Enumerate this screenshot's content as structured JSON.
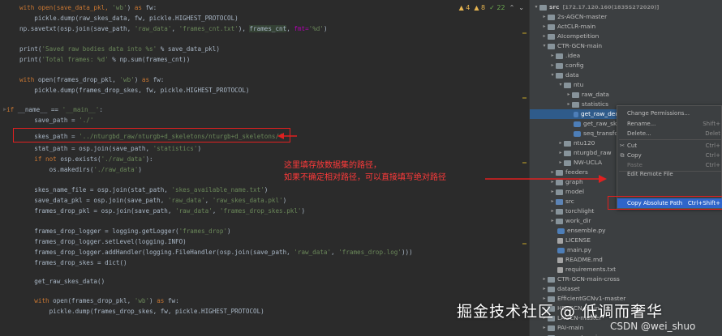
{
  "editor": {
    "toolbar": {
      "warnings": "▲ 4",
      "weak": "▲ 8",
      "typos": "✓ 22",
      "nav_up": "⌃",
      "nav_down": "⌄"
    },
    "code": {
      "l1": [
        "with open(save_data_pkl, ",
        "'wb'",
        ") ",
        "as ",
        "fw:"
      ],
      "l2": [
        "    pickle.dump(raw_skes_data, fw, pickle.HIGHEST_PROTOCOL)"
      ],
      "l3": [
        "np.savetxt(osp.join(save_path, ",
        "'raw_data'",
        ", ",
        "'frames_cnt.txt'",
        "), ",
        "frames_cnt",
        ", ",
        "fmt=",
        "'%d'",
        ")"
      ],
      "l4": [
        "print(",
        "'Saved raw bodies data into %s'",
        " % save_data_pkl)"
      ],
      "l5": [
        "print(",
        "'Total frames: %d'",
        " % np.sum(frames_cnt))"
      ],
      "l6": [
        "with ",
        "open(frames_drop_pkl, ",
        "'wb'",
        ") ",
        "as ",
        "fw:"
      ],
      "l7": [
        "    pickle.dump(frames_drop_skes, fw, pickle.HIGHEST_PROTOCOL)"
      ],
      "l8": [
        "if ",
        "__name__ == ",
        "'__main__'",
        ":"
      ],
      "l9": [
        "    save_path = ",
        "'./'"
      ],
      "l10": [
        "    skes_path = ",
        "'../nturgbd_raw/nturgb+d_skeletons/nturgb+d_skeletons/'"
      ],
      "l11": [
        "    stat_path = osp.join(save_path, ",
        "'statistics'",
        ")"
      ],
      "l12": [
        "    ",
        "if not ",
        "osp.exists(",
        "'./raw_data'",
        "):"
      ],
      "l13": [
        "        os.makedirs(",
        "'./raw_data'",
        ")"
      ],
      "l14": [
        "    skes_name_file = osp.join(stat_path, ",
        "'skes_available_name.txt'",
        ")"
      ],
      "l15": [
        "    save_data_pkl = osp.join(save_path, ",
        "'raw_data'",
        ", ",
        "'raw_skes_data.pkl'",
        ")"
      ],
      "l16": [
        "    frames_drop_pkl = osp.join(save_path, ",
        "'raw_data'",
        ", ",
        "'frames_drop_skes.pkl'",
        ")"
      ],
      "l17": [
        "    frames_drop_logger = logging.getLogger(",
        "'frames_drop'",
        ")"
      ],
      "l18": [
        "    frames_drop_logger.setLevel(logging.INFO)"
      ],
      "l19": [
        "    frames_drop_logger.addHandler(logging.FileHandler(osp.join(save_path, ",
        "'raw_data'",
        ", ",
        "'frames_drop.log'",
        ")))"
      ],
      "l20": [
        "    frames_drop_skes = dict()"
      ],
      "l21": [
        "    get_raw_skes_data()"
      ],
      "l22": [
        "    ",
        "with ",
        "open(frames_drop_pkl, ",
        "'wb'",
        ") ",
        "as ",
        "fw:"
      ],
      "l23": [
        "        pickle.dump(frames_drop_skes, fw, pickle.HIGHEST_PROTOCOL)"
      ]
    },
    "annotation": {
      "line1": "这里填存放数据集的路径，",
      "line2": "如果不确定相对路径，可以直接填写绝对路径"
    }
  },
  "tree": {
    "root": "src",
    "root_host": "[172.17.120.160(1835S272020)]",
    "items": [
      "2s-AGCN-master",
      "ActCLR-main",
      "AIcompetition",
      "CTR-GCN-main",
      ".idea",
      "config",
      "data",
      "ntu",
      "raw_data",
      "statistics",
      "get_raw_denoised_data.py",
      "get_raw_skes_data.py",
      "seq_transformation.py",
      "ntu120",
      "nturgbd_raw",
      "NW-UCLA",
      "feeders",
      "graph",
      "model",
      "src",
      "torchlight",
      "work_dir",
      "ensemble.py",
      "LICENSE",
      "main.py",
      "README.md",
      "requirements.txt",
      "CTR-GCN-main-cross",
      "dataset",
      "EfficientGCNv1-master",
      "HD-GCN-main",
      "LAGCN-master",
      "PAI-main",
      "psumnet-main"
    ],
    "visible_labels": {
      "i10": "get_raw_den",
      "i11": "get_raw_ske",
      "i12": "seq_transfor",
      "i13": "ntu120",
      "i18": "model"
    }
  },
  "context_menu": {
    "items": [
      {
        "icon": "",
        "label": "Change Permissions...",
        "shortcut": ""
      },
      {
        "icon": "",
        "label": "Rename...",
        "shortcut": "Shift+"
      },
      {
        "icon": "",
        "label": "Delete...",
        "shortcut": "Delet"
      },
      {
        "icon": "✂",
        "label": "Cut",
        "shortcut": "Ctrl+"
      },
      {
        "icon": "⧉",
        "label": "Copy",
        "shortcut": "Ctrl+"
      },
      {
        "icon": "",
        "label": "Paste",
        "shortcut": "Ctrl+"
      },
      {
        "icon": "",
        "label": "Edit Remote File",
        "shortcut": ""
      },
      {
        "icon": "",
        "label": "Copy Absolute Path",
        "shortcut": "Ctrl+Shift+"
      }
    ]
  },
  "watermark": {
    "main": "掘金技术社区 @ 低调而奢华",
    "csdn": "CSDN @wei_shuo"
  }
}
